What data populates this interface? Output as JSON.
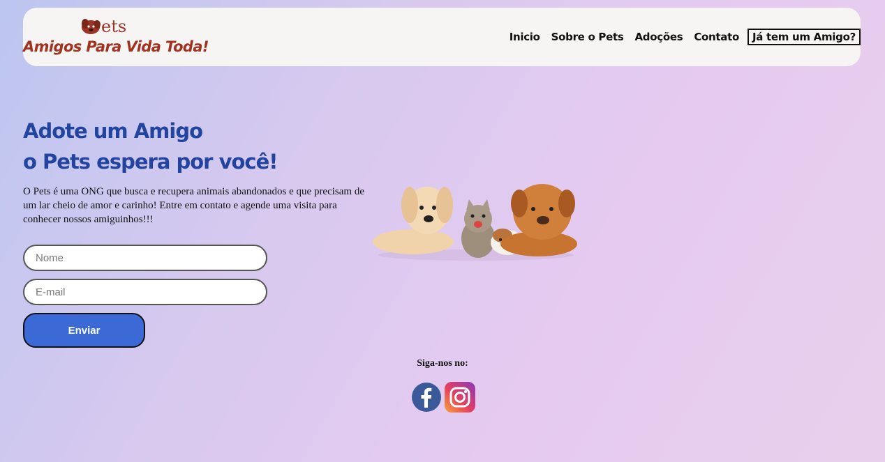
{
  "header": {
    "logo_ets": "ets",
    "logo_tagline": "Amigos Para Vida Toda!",
    "nav": [
      {
        "label": "Inicio"
      },
      {
        "label": "Sobre o Pets"
      },
      {
        "label": "Adoções"
      },
      {
        "label": "Contato"
      },
      {
        "label": "Já tem um Amigo?"
      }
    ]
  },
  "hero": {
    "title_line1": "Adote um Amigo",
    "title_line2": "o Pets espera por você!",
    "description": "O Pets é uma ONG que busca e recupera animais abandonados e que precisam de um lar cheio de amor e carinho! Entre em contato e agende uma visita para conhecer nossos amiguinhos!!!"
  },
  "form": {
    "name_placeholder": "Nome",
    "email_placeholder": "E-mail",
    "submit_label": "Enviar"
  },
  "footer": {
    "follow_label": "Siga-nos no:",
    "social": [
      "facebook-icon",
      "instagram-icon"
    ]
  },
  "colors": {
    "accent": "#23449e",
    "logo": "#a23220",
    "button": "#3b6ad6"
  }
}
